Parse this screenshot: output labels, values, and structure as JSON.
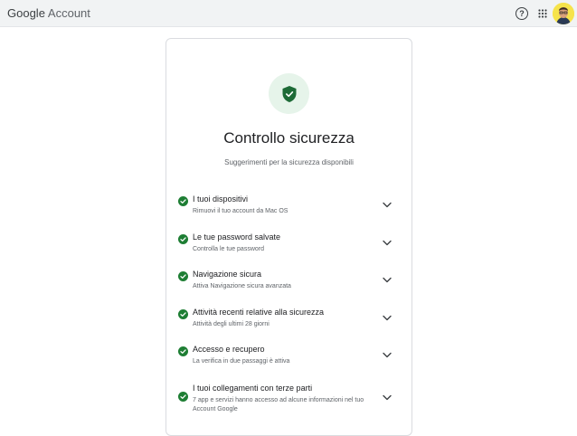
{
  "header": {
    "brand_google": "Google",
    "brand_account": "Account",
    "help_glyph": "?"
  },
  "page": {
    "title": "Controllo sicurezza",
    "subtitle": "Suggerimenti per la sicurezza disponibili"
  },
  "items": [
    {
      "label": "I tuoi dispositivi",
      "description": "Rimuovi il tuo account da Mac OS",
      "status": "ok"
    },
    {
      "label": "Le tue password salvate",
      "description": "Controlla le tue password",
      "status": "ok"
    },
    {
      "label": "Navigazione sicura",
      "description": "Attiva Navigazione sicura avanzata",
      "status": "ok"
    },
    {
      "label": "Attività recenti relative alla sicurezza",
      "description": "Attività degli ultimi 28 giorni",
      "status": "ok"
    },
    {
      "label": "Accesso e recupero",
      "description": "La verifica in due passaggi è attiva",
      "status": "ok"
    },
    {
      "label": "I tuoi collegamenti con terze parti",
      "description": "7 app e servizi hanno accesso ad alcune informazioni nel tuo Account Google",
      "status": "ok"
    }
  ],
  "colors": {
    "check": "#1e7e34",
    "shield": "#1e6b37",
    "shield_bg": "#e6f4ea"
  },
  "icons": {
    "help": "help-circle-icon",
    "apps": "apps-grid-icon",
    "avatar": "user-avatar",
    "shield": "shield-check-icon",
    "check": "check-circle-icon",
    "chevron": "chevron-down-icon"
  }
}
